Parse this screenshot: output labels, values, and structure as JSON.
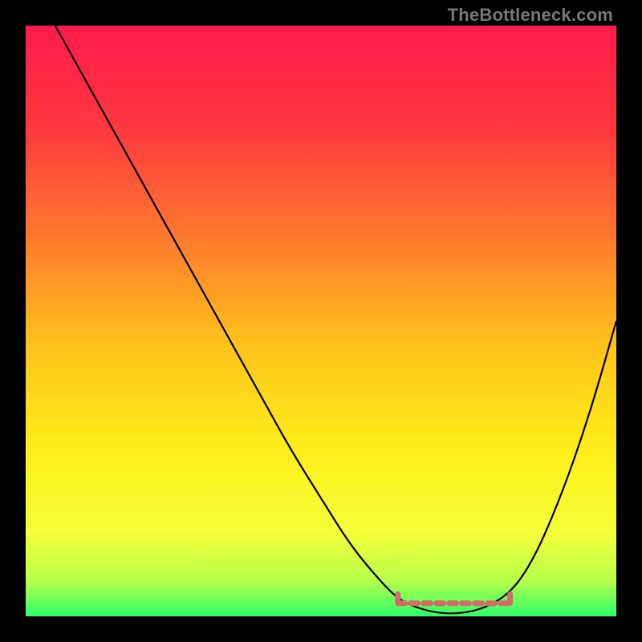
{
  "watermark": "TheBottleneck.com",
  "chart_data": {
    "type": "line",
    "title": "",
    "xlabel": "",
    "ylabel": "",
    "xlim": [
      0,
      100
    ],
    "ylim": [
      0,
      100
    ],
    "grid": false,
    "legend": false,
    "background_gradient": {
      "stops": [
        {
          "offset": 0.0,
          "color": "#ff1a4b"
        },
        {
          "offset": 0.18,
          "color": "#ff3a3f"
        },
        {
          "offset": 0.36,
          "color": "#ff7a2e"
        },
        {
          "offset": 0.54,
          "color": "#ffc21a"
        },
        {
          "offset": 0.72,
          "color": "#ffef1a"
        },
        {
          "offset": 0.86,
          "color": "#f4ff3a"
        },
        {
          "offset": 0.94,
          "color": "#b6ff4a"
        },
        {
          "offset": 1.0,
          "color": "#2eff6a"
        }
      ]
    },
    "series": [
      {
        "name": "bottleneck-curve",
        "color": "#000000",
        "x": [
          5.0,
          10,
          15,
          20,
          25,
          30,
          35,
          40,
          45,
          50,
          55,
          60,
          63,
          66,
          70,
          74,
          78,
          82,
          85,
          88,
          92,
          96,
          100
        ],
        "y": [
          100,
          91,
          82,
          73,
          64,
          55,
          46,
          37,
          28,
          20,
          12,
          6,
          3,
          1.5,
          0.5,
          0.5,
          1.5,
          4,
          8,
          14,
          24,
          36,
          50
        ]
      }
    ],
    "markers": [
      {
        "name": "range-left-cap",
        "x": 63,
        "y": 3.0,
        "color": "#d46a6a",
        "r": 4
      },
      {
        "name": "range-right-cap",
        "x": 82,
        "y": 3.0,
        "color": "#d46a6a",
        "r": 4
      }
    ],
    "highlight_band": {
      "name": "optimal-range",
      "x_start": 63,
      "x_end": 82,
      "y": 2.2,
      "color": "#d46a6a"
    }
  }
}
